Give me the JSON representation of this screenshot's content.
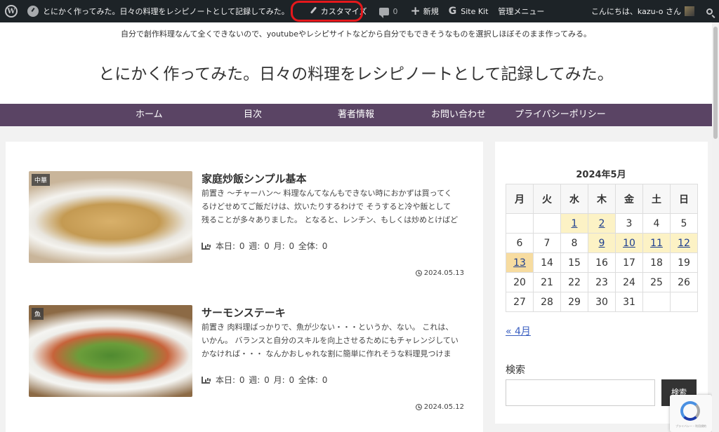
{
  "adminbar": {
    "site_title": "とにかく作ってみた。日々の料理をレシピノートとして記録してみた。",
    "customize": "カスタマイズ",
    "comments_count": "0",
    "new": "新規",
    "sitekit": "Site Kit",
    "admin_menu": "管理メニュー",
    "greeting": "こんにちは、kazu-o さん"
  },
  "header": {
    "tagline": "自分で創作料理なんて全くできないので、youtubeやレシピサイトなどから自分でもできそうなものを選択しほぼそのまま作ってみる。",
    "title": "とにかく作ってみた。日々の料理をレシピノートとして記録してみた。"
  },
  "nav": {
    "items": [
      {
        "label": "ホーム"
      },
      {
        "label": "目次"
      },
      {
        "label": "著者情報"
      },
      {
        "label": "お問い合わせ"
      },
      {
        "label": "プライバシーポリシー"
      }
    ]
  },
  "posts": [
    {
      "category": "中華",
      "title": "家庭炒飯シンプル基本",
      "snippet": "前置き 〜チャーハン〜 料理なんてなんもできない時におかずは買ってくるけどせめてご飯だけは、炊いたりするわけで そうすると冷や飯として残ることが多々ありました。 となると、レンチン、もしくは炒めとけばどうにかなりそうなもの・・・チャーハンか...",
      "stats": "本日: 0 週: 0 月: 0 全体: 0",
      "date": "2024.05.13"
    },
    {
      "category": "魚",
      "title": "サーモンステーキ",
      "snippet": "前置き 肉料理ばっかりで、魚が少ない・・・というか、ない。 これは、いかん。 バランスと自分のスキルを向上させるためにもチャレンジしていかなければ・・・ なんかおしゃれな割に簡単に作れそうな料理見つけました！ 参考にしたサイト・Instag...",
      "stats": "本日: 0 週: 0 月: 0 全体: 0",
      "date": "2024.05.12"
    }
  ],
  "calendar": {
    "caption": "2024年5月",
    "weekdays": [
      "月",
      "火",
      "水",
      "木",
      "金",
      "土",
      "日"
    ],
    "weeks": [
      [
        "",
        "",
        "1",
        "2",
        "3",
        "4",
        "5"
      ],
      [
        "6",
        "7",
        "8",
        "9",
        "10",
        "11",
        "12"
      ],
      [
        "13",
        "14",
        "15",
        "16",
        "17",
        "18",
        "19"
      ],
      [
        "20",
        "21",
        "22",
        "23",
        "24",
        "25",
        "26"
      ],
      [
        "27",
        "28",
        "29",
        "30",
        "31",
        "",
        ""
      ]
    ],
    "linked_days": [
      "1",
      "2",
      "9",
      "10",
      "11",
      "12",
      "13"
    ],
    "today": "13",
    "prev": "« 4月"
  },
  "search": {
    "label": "検索",
    "button": "検索"
  },
  "recaptcha": {
    "text": "プライバシー・利用規約"
  },
  "colors": {
    "adminbar_bg": "#1d2327",
    "nav_bg": "#5a4464",
    "annotation": "#e5181c",
    "calendar_linked": "#fcf2c5"
  }
}
